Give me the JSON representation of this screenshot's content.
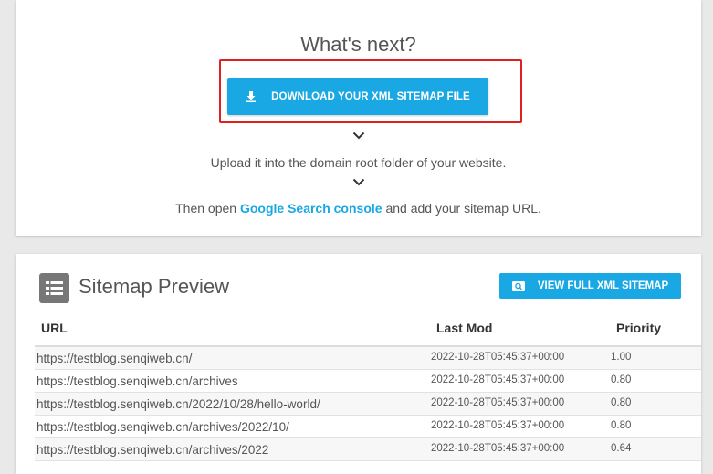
{
  "next": {
    "title": "What's next?",
    "download_label": "DOWNLOAD YOUR XML SITEMAP FILE",
    "step1": "Upload it into the domain root folder of your website.",
    "step2_prefix": "Then open ",
    "step2_link": "Google Search console",
    "step2_suffix": " and add your sitemap URL."
  },
  "preview": {
    "title": "Sitemap Preview",
    "view_label": "VIEW FULL XML SITEMAP",
    "columns": {
      "url": "URL",
      "lastmod": "Last Mod",
      "priority": "Priority"
    },
    "rows": [
      {
        "url": "https://testblog.senqiweb.cn/",
        "lastmod": "2022-10-28T05:45:37+00:00",
        "priority": "1.00"
      },
      {
        "url": "https://testblog.senqiweb.cn/archives",
        "lastmod": "2022-10-28T05:45:37+00:00",
        "priority": "0.80"
      },
      {
        "url": "https://testblog.senqiweb.cn/2022/10/28/hello-world/",
        "lastmod": "2022-10-28T05:45:37+00:00",
        "priority": "0.80"
      },
      {
        "url": "https://testblog.senqiweb.cn/archives/2022/10/",
        "lastmod": "2022-10-28T05:45:37+00:00",
        "priority": "0.80"
      },
      {
        "url": "https://testblog.senqiweb.cn/archives/2022",
        "lastmod": "2022-10-28T05:45:37+00:00",
        "priority": "0.64"
      }
    ]
  },
  "colors": {
    "accent": "#1aa8e4",
    "highlight": "#e0201d",
    "icon_bg": "#777777"
  },
  "icons": {
    "download": "download-icon",
    "chevron": "chevron-down-icon",
    "view": "search-icon",
    "preview": "list-icon"
  }
}
